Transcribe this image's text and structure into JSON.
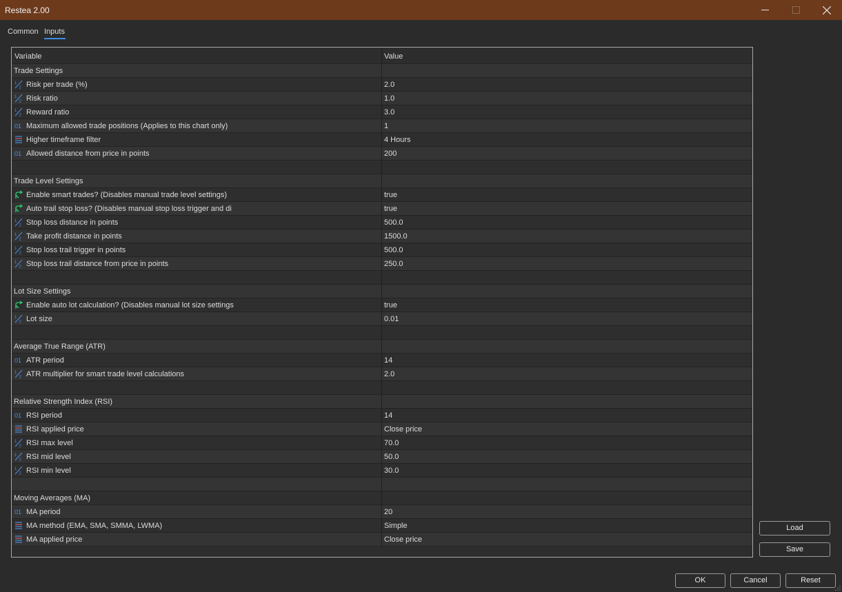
{
  "window": {
    "title": "Restea 2.00"
  },
  "tabs": [
    {
      "label": "Common",
      "active": false
    },
    {
      "label": "Inputs",
      "active": true
    }
  ],
  "grid": {
    "headers": {
      "variable": "Variable",
      "value": "Value"
    },
    "rows": [
      {
        "type": "group",
        "label": "Trade Settings"
      },
      {
        "type": "item",
        "icon": "fraction-icon",
        "label": "Risk per trade (%)",
        "value": "2.0"
      },
      {
        "type": "item",
        "icon": "fraction-icon",
        "label": "Risk ratio",
        "value": "1.0"
      },
      {
        "type": "item",
        "icon": "fraction-icon",
        "label": "Reward ratio",
        "value": "3.0"
      },
      {
        "type": "item",
        "icon": "integer-icon",
        "label": "Maximum allowed trade positions (Applies to this chart only)",
        "value": "1"
      },
      {
        "type": "item",
        "icon": "enum-icon",
        "label": "Higher timeframe filter",
        "value": "4 Hours"
      },
      {
        "type": "item",
        "icon": "integer-icon",
        "label": "Allowed distance from price in points",
        "value": "200"
      },
      {
        "type": "blank"
      },
      {
        "type": "group",
        "label": "Trade Level Settings"
      },
      {
        "type": "item",
        "icon": "bool-icon",
        "label": "Enable smart trades? (Disables manual trade level settings)",
        "value": "true"
      },
      {
        "type": "item",
        "icon": "bool-icon",
        "label": "Auto trail stop loss? (Disables manual stop loss trigger and di",
        "value": "true"
      },
      {
        "type": "item",
        "icon": "fraction-icon",
        "label": "Stop loss distance in points",
        "value": "500.0"
      },
      {
        "type": "item",
        "icon": "fraction-icon",
        "label": "Take profit distance in points",
        "value": "1500.0"
      },
      {
        "type": "item",
        "icon": "fraction-icon",
        "label": "Stop loss trail trigger in points",
        "value": "500.0"
      },
      {
        "type": "item",
        "icon": "fraction-icon",
        "label": "Stop loss trail distance from price in points",
        "value": "250.0"
      },
      {
        "type": "blank"
      },
      {
        "type": "group",
        "label": "Lot Size Settings"
      },
      {
        "type": "item",
        "icon": "bool-icon",
        "label": "Enable auto lot calculation? (Disables manual lot size settings",
        "value": "true"
      },
      {
        "type": "item",
        "icon": "fraction-icon",
        "label": "Lot size",
        "value": "0.01"
      },
      {
        "type": "blank"
      },
      {
        "type": "group",
        "label": "Average True Range (ATR)"
      },
      {
        "type": "item",
        "icon": "integer-icon",
        "label": "ATR period",
        "value": "14"
      },
      {
        "type": "item",
        "icon": "fraction-icon",
        "label": "ATR multiplier for smart trade level calculations",
        "value": "2.0"
      },
      {
        "type": "blank"
      },
      {
        "type": "group",
        "label": "Relative Strength Index (RSI)"
      },
      {
        "type": "item",
        "icon": "integer-icon",
        "label": "RSI period",
        "value": "14"
      },
      {
        "type": "item",
        "icon": "enum-icon",
        "label": "RSI applied price",
        "value": "Close price"
      },
      {
        "type": "item",
        "icon": "fraction-icon",
        "label": "RSI max level",
        "value": "70.0"
      },
      {
        "type": "item",
        "icon": "fraction-icon",
        "label": "RSI mid level",
        "value": "50.0"
      },
      {
        "type": "item",
        "icon": "fraction-icon",
        "label": "RSI min level",
        "value": "30.0"
      },
      {
        "type": "blank"
      },
      {
        "type": "group",
        "label": "Moving Averages (MA)"
      },
      {
        "type": "item",
        "icon": "integer-icon",
        "label": "MA period",
        "value": "20"
      },
      {
        "type": "item",
        "icon": "enum-icon",
        "label": "MA method (EMA, SMA, SMMA, LWMA)",
        "value": "Simple"
      },
      {
        "type": "item",
        "icon": "enum-icon",
        "label": "MA applied price",
        "value": "Close price"
      }
    ]
  },
  "buttons": {
    "load": "Load",
    "save": "Save",
    "ok": "OK",
    "cancel": "Cancel",
    "reset": "Reset"
  },
  "colors": {
    "titlebar": "#6d3a1c",
    "accent": "#3b8ee6",
    "bool_icon": "#2ecc71",
    "number_icon": "#4a90e2"
  }
}
